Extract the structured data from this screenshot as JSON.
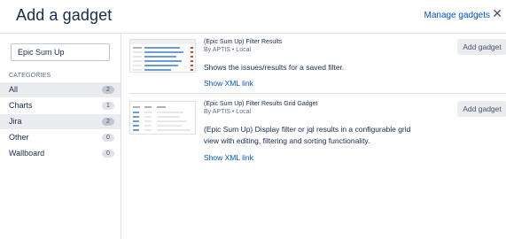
{
  "header": {
    "title": "Add a gadget",
    "manage_link": "Manage gadgets",
    "close_icon": "close-icon"
  },
  "sidebar": {
    "search_value": "Epic Sum Up",
    "categories_header": "CATEGORIES",
    "categories": [
      {
        "label": "All",
        "count": "2",
        "active": true
      },
      {
        "label": "Charts",
        "count": "1",
        "active": false
      },
      {
        "label": "Jira",
        "count": "2",
        "active": true
      },
      {
        "label": "Other",
        "count": "0",
        "active": false
      },
      {
        "label": "Wallboard",
        "count": "0",
        "active": false
      }
    ]
  },
  "gadgets": [
    {
      "title": "(Epic Sum Up) Filter Results",
      "by": "By APTIS • Local",
      "description": "Shows the issues/results for a saved filter.",
      "xml_link": "Show XML link",
      "add_label": "Add gadget",
      "thumbnail_icon": "filter-results-thumbnail"
    },
    {
      "title": "(Epic Sum Up) Filter Results Grid Gadget",
      "by": "By APTIS • Local",
      "description": "(Epic Sum Up) Display filter or jql results in a configurable grid view with editing, filtering and sorting functionality.",
      "xml_link": "Show XML link",
      "add_label": "Add gadget",
      "thumbnail_icon": "grid-gadget-thumbnail"
    }
  ],
  "colors": {
    "link": "#0052cc",
    "text": "#172b4d",
    "muted": "#5e6c84",
    "active_bg": "#ebecf0",
    "button_bg": "#ebecf0"
  }
}
